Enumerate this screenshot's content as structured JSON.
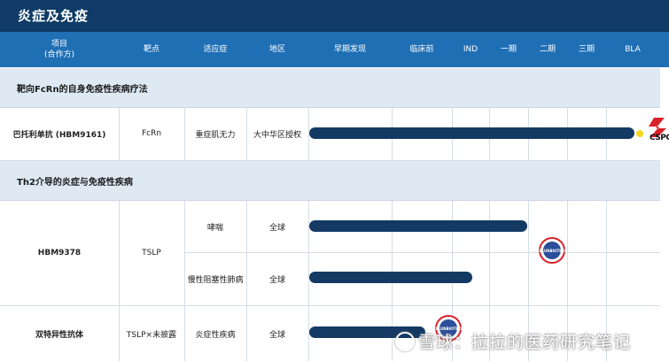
{
  "title": "炎症及免疫",
  "headers": {
    "project_line1": "项目",
    "project_line2": "(合作方)",
    "target": "靶点",
    "indication": "适应症",
    "region": "地区",
    "early": "早期发现",
    "preclinical": "临床前",
    "ind": "IND",
    "phase1": "一期",
    "phase2": "二期",
    "phase3": "三期",
    "bla": "BLA"
  },
  "sections": [
    {
      "label": "靶向FcRn的自身免疫性疾病疗法",
      "rows": [
        {
          "project": "巴托利单抗 (HBM9161)",
          "target": "FcRn",
          "indication": "重症肌无力",
          "region": "大中华区授权",
          "progress": "BLA",
          "partner_logo": "CSPC"
        }
      ]
    },
    {
      "label": "Th2介导的炎症与免疫性疾病",
      "rows": [
        {
          "project": "HBM9378",
          "target": "TSLP",
          "indication": "哮喘",
          "region": "全球",
          "progress": "二期",
          "partner_logo": "KELUN BIOTECH"
        },
        {
          "project": "HBM9378",
          "target": "TSLP",
          "indication": "慢性阻塞性肺病",
          "region": "全球",
          "progress": "一期"
        },
        {
          "project": "双特异性抗体",
          "target": "TSLP×未披露",
          "indication": "炎症性疾病",
          "region": "全球",
          "progress": "临床前",
          "partner_logo": "KELUN BIOTECH"
        }
      ]
    }
  ],
  "logos": {
    "cspc": "CSPC",
    "kelun_top": "KELUN",
    "kelun_bottom": "BIOTECH"
  },
  "watermark": "雪球：拉拉的医药研究笔记",
  "colors": {
    "title_bg": "#0f3b66",
    "header_bg": "#1f6fb5",
    "section_bg": "#dfe9f4",
    "bar": "#143a63",
    "bla_dot": "#f4d81c",
    "badge_ring": "#d8222a"
  }
}
